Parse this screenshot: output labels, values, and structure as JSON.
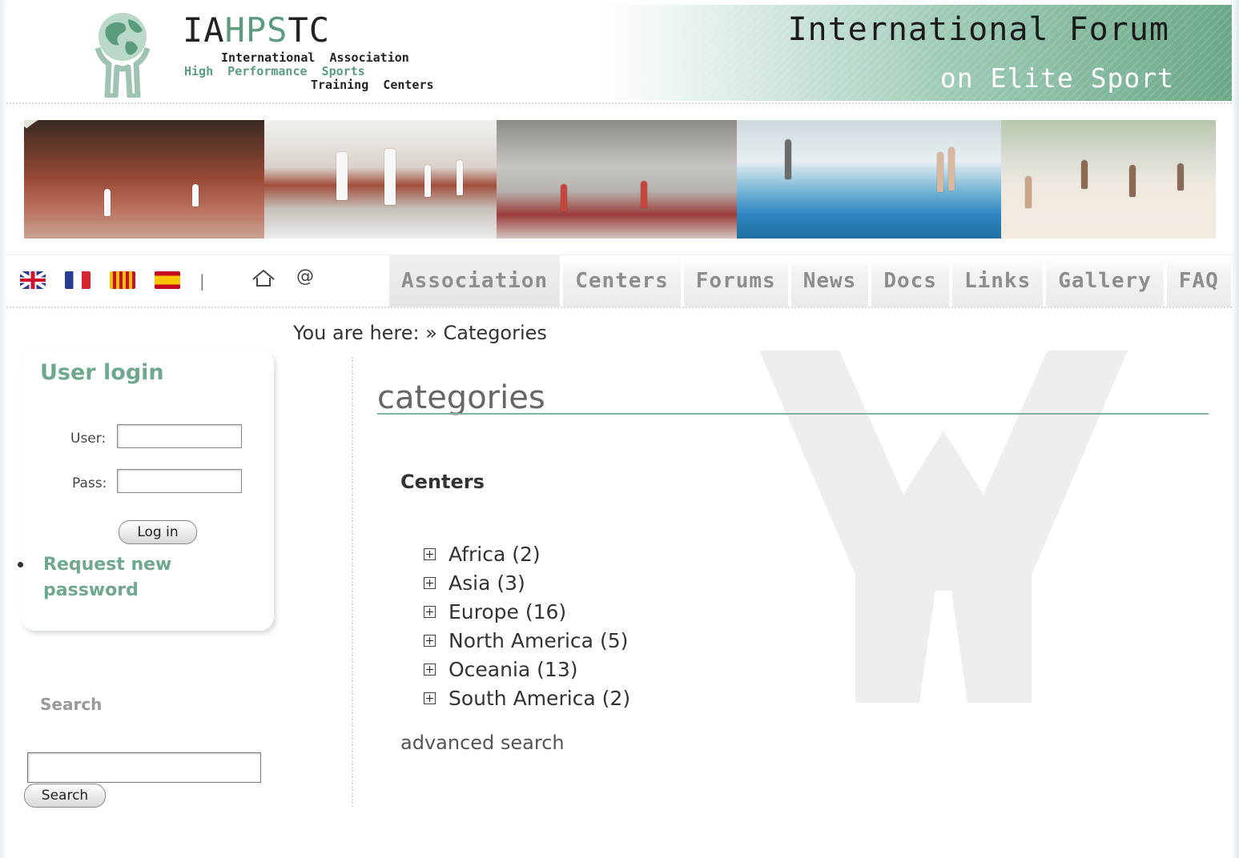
{
  "header": {
    "brand": {
      "prefix": "IA",
      "highlight": "HPS",
      "suffix": "TC"
    },
    "brand_sub": {
      "line1": "International  Association",
      "line2": "High  Performance  Sports",
      "line3": "Training  Centers"
    },
    "forum_title": "International Forum",
    "forum_subtitle": "on Elite Sport"
  },
  "nav": {
    "separator": "|",
    "at_symbol": "@",
    "tabs": [
      "Association",
      "Centers",
      "Forums",
      "News",
      "Docs",
      "Links",
      "Gallery",
      "FAQ"
    ]
  },
  "breadcrumb": "You are here: » Categories",
  "sidebar": {
    "login": {
      "title": "User login",
      "user_label": "User:",
      "pass_label": "Pass:",
      "user_value": "",
      "pass_value": "",
      "login_button": "Log in",
      "request_link": "Request new password"
    },
    "search": {
      "label": "Search",
      "value": "",
      "button": "Search"
    }
  },
  "main": {
    "title": "categories",
    "section": "Centers",
    "categories": [
      {
        "label": "Africa (2)"
      },
      {
        "label": "Asia (3)"
      },
      {
        "label": "Europe (16)"
      },
      {
        "label": "North America (5)"
      },
      {
        "label": "Oceania (13)"
      },
      {
        "label": "South America (2)"
      }
    ],
    "advanced_search": "advanced search"
  },
  "colors": {
    "accent_green": "#6fa98d",
    "header_band": "#6aa889"
  }
}
